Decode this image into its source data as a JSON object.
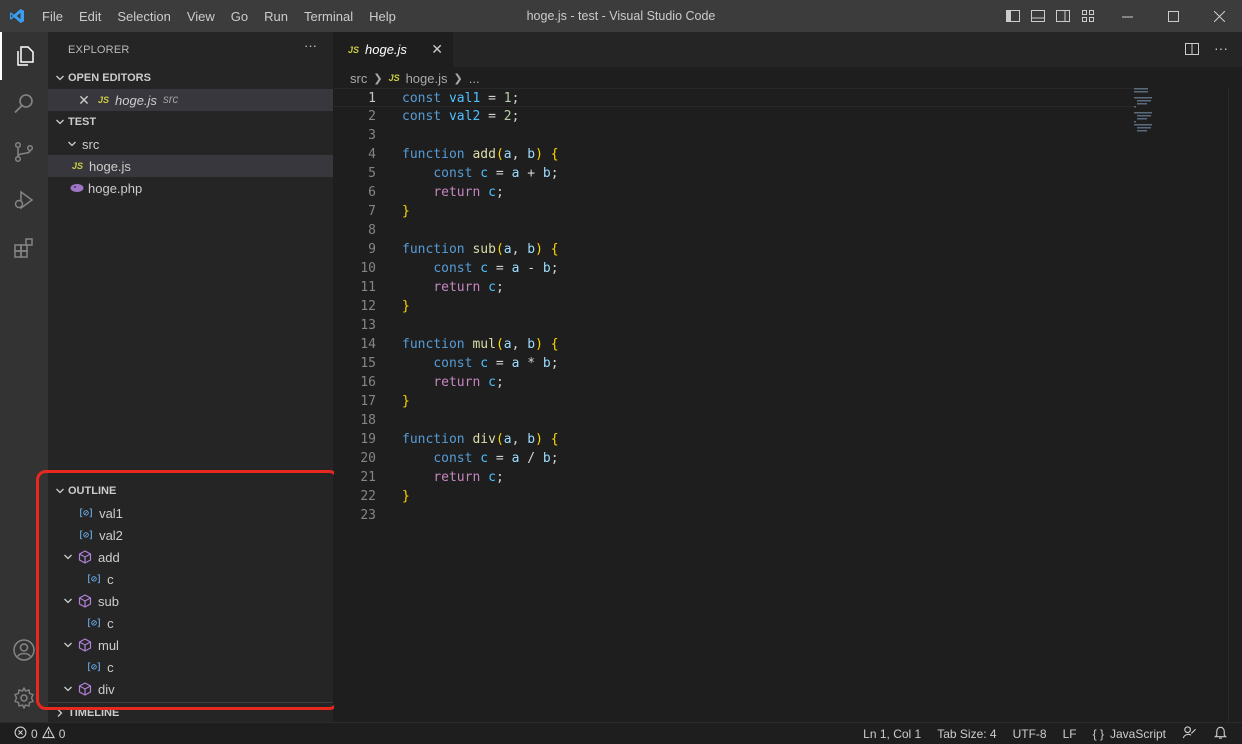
{
  "app": {
    "title": "hoge.js - test - Visual Studio Code",
    "menu": [
      "File",
      "Edit",
      "Selection",
      "View",
      "Go",
      "Run",
      "Terminal",
      "Help"
    ]
  },
  "sidebar": {
    "title": "EXPLORER",
    "open_editors": {
      "header": "OPEN EDITORS",
      "items": [
        {
          "icon": "JS",
          "name": "hoge.js",
          "desc": "src"
        }
      ]
    },
    "workspace": {
      "header": "TEST",
      "folder": "src",
      "files": [
        {
          "icon": "JS",
          "name": "hoge.js"
        },
        {
          "name": "hoge.php"
        }
      ]
    },
    "outline": {
      "header": "OUTLINE",
      "items": [
        {
          "kind": "variable",
          "name": "val1"
        },
        {
          "kind": "variable",
          "name": "val2"
        },
        {
          "kind": "function",
          "name": "add"
        },
        {
          "kind": "variable",
          "name": "c"
        },
        {
          "kind": "function",
          "name": "sub"
        },
        {
          "kind": "variable",
          "name": "c"
        },
        {
          "kind": "function",
          "name": "mul"
        },
        {
          "kind": "variable",
          "name": "c"
        },
        {
          "kind": "function",
          "name": "div"
        }
      ]
    },
    "timeline": {
      "header": "TIMELINE"
    }
  },
  "editor": {
    "tab": {
      "icon": "JS",
      "label": "hoge.js"
    },
    "breadcrumb": [
      "src",
      "hoge.js",
      "..."
    ],
    "breadcrumb_icon": "JS",
    "line_numbers": [
      "1",
      "2",
      "3",
      "4",
      "5",
      "6",
      "7",
      "8",
      "9",
      "10",
      "11",
      "12",
      "13",
      "14",
      "15",
      "16",
      "17",
      "18",
      "19",
      "20",
      "21",
      "22",
      "23"
    ]
  },
  "status": {
    "errors": "0",
    "warnings": "0",
    "cursor": "Ln 1, Col 1",
    "tab_size": "Tab Size: 4",
    "encoding": "UTF-8",
    "eol": "LF",
    "language": "JavaScript",
    "language_icon": "{ }"
  },
  "colors": {
    "accent_red": "#e8281e",
    "js_icon": "#cbcb41",
    "php_icon": "#a074c4",
    "symbol_var": "#75beff",
    "symbol_fn": "#b180d7"
  }
}
